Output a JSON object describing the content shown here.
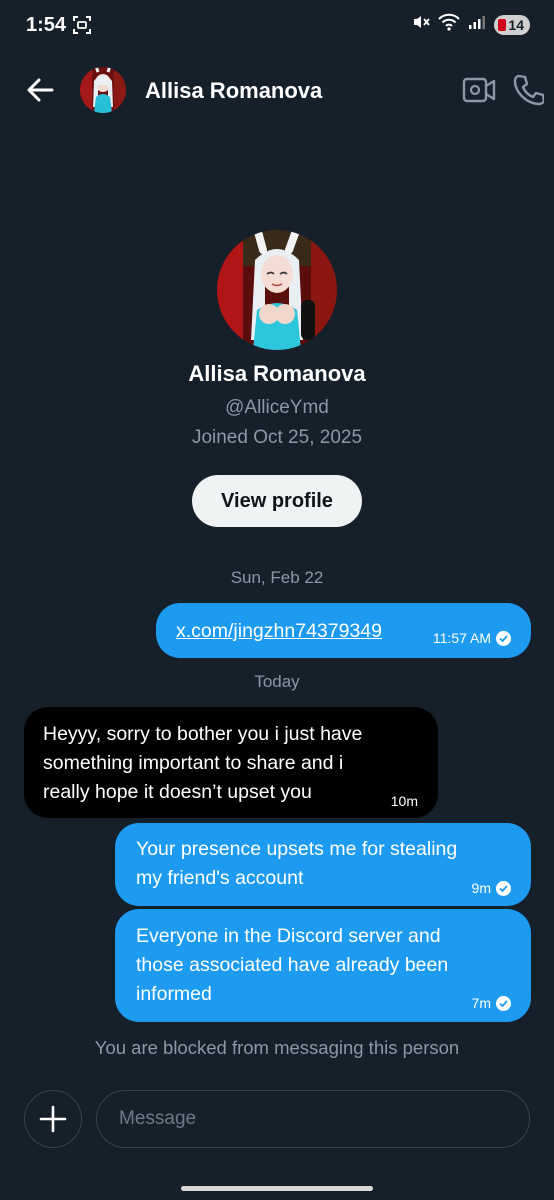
{
  "status_bar": {
    "time": "1:54",
    "battery": "14"
  },
  "header": {
    "name": "Allisa Romanova"
  },
  "profile": {
    "name": "Allisa Romanova",
    "handle": "@AlliceYmd",
    "joined": "Joined Oct 25, 2025",
    "view_profile_label": "View profile"
  },
  "conversation": {
    "date_1": "Sun, Feb 22",
    "msg_1": {
      "text": "x.com/jingzhn74379349",
      "time": "11:57 AM"
    },
    "date_2": "Today",
    "msg_2": {
      "text_lines": [
        "Heyyy, sorry to bother you i just have",
        "something important to share and i",
        "really hope it doesn’t upset you"
      ],
      "time": "10m"
    },
    "msg_3": {
      "text_lines": [
        "Your presence upsets me for stealing",
        "my friend's account"
      ],
      "time": "9m"
    },
    "msg_4": {
      "text_lines": [
        "Everyone in the Discord server and",
        "those associated have already been",
        "informed"
      ],
      "time": "7m"
    }
  },
  "blocked_notice": "You are blocked from messaging this person",
  "composer": {
    "placeholder": "Message"
  },
  "colors": {
    "background": "#15202b",
    "accent": "#1d9bf0",
    "incoming_bubble": "#000000",
    "muted_text": "#8b98a5"
  }
}
